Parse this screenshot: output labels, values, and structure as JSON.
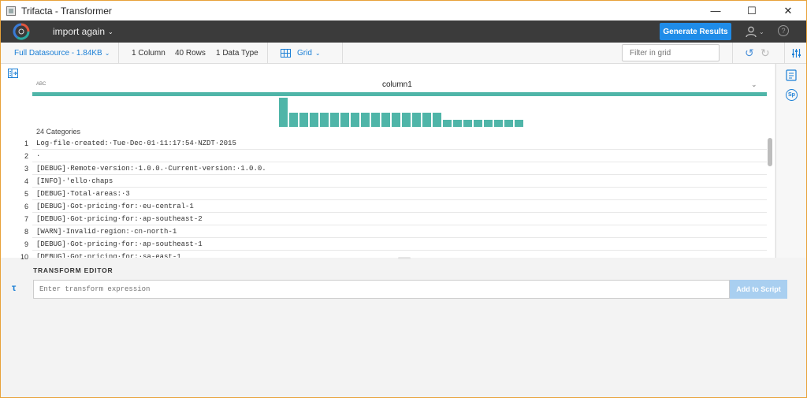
{
  "window": {
    "title": "Trifacta - Transformer"
  },
  "appbar": {
    "flow_name": "import again",
    "generate_label": "Generate Results"
  },
  "toolbar": {
    "datasource": "Full Datasource - 1.84KB",
    "columns": "1 Column",
    "rows": "40 Rows",
    "datatypes": "1 Data Type",
    "view": "Grid",
    "filter_placeholder": "Filter in grid"
  },
  "grid": {
    "column": {
      "type": "ABC",
      "name": "column1"
    },
    "categories_label": "24 Categories",
    "histogram": [
      1.0,
      0.48,
      0.48,
      0.48,
      0.48,
      0.48,
      0.48,
      0.48,
      0.48,
      0.48,
      0.48,
      0.48,
      0.48,
      0.48,
      0.48,
      0.48,
      0.24,
      0.24,
      0.24,
      0.24,
      0.24,
      0.24,
      0.24,
      0.24
    ],
    "row_numbers": [
      "1",
      "2",
      "3",
      "4",
      "5",
      "6",
      "7",
      "8",
      "9",
      "10"
    ],
    "rows": [
      "Log·file·created:·Tue·Dec·01·11:17:54·NZDT·2015",
      "·",
      "[DEBUG]·Remote·version:·1.0.0.·Current·version:·1.0.0.",
      "[INFO]·'ello·chaps",
      "[DEBUG]·Total·areas:·3",
      "[DEBUG]·Got·pricing·for:·eu-central-1",
      "[DEBUG]·Got·pricing·for:·ap-southeast-2",
      "[WARN]·Invalid·region:·cn-north-1",
      "[DEBUG]·Got·pricing·for:·ap-southeast-1",
      "[DEBUG]·Got·pricing·for:·sa-east-1"
    ]
  },
  "editor": {
    "title": "TRANSFORM EDITOR",
    "placeholder": "Enter transform expression",
    "add_label": "Add to Script"
  },
  "colors": {
    "accent": "#1f8ce8",
    "histogram": "#4fb5a8",
    "header": "#3b3b3b"
  }
}
